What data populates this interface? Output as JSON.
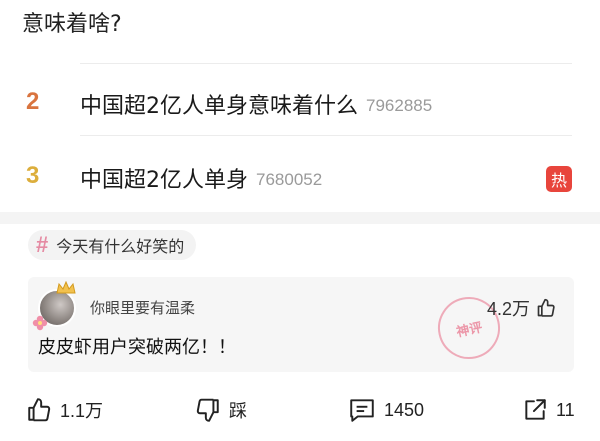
{
  "question": "意味着啥?",
  "hot_list": [
    {
      "rank": "2",
      "rank_color": "#d9743f",
      "title": "中国超2亿人单身意味着什么",
      "count": "7962885",
      "badge": ""
    },
    {
      "rank": "3",
      "rank_color": "#dcae3c",
      "title": "中国超2亿人单身",
      "count": "7680052",
      "badge": "热"
    }
  ],
  "topic": {
    "icon": "hash-icon",
    "label": "今天有什么好笑的"
  },
  "comment": {
    "username": "你眼里要有温柔",
    "likes": "4.2万",
    "text": "皮皮虾用户突破两亿！！",
    "stamp": "神评"
  },
  "actions": {
    "like": "1.1万",
    "dislike": "踩",
    "comments": "1450",
    "share": "11"
  },
  "colors": {
    "hot_badge": "#e8453c",
    "hash": "#e58ba3"
  }
}
